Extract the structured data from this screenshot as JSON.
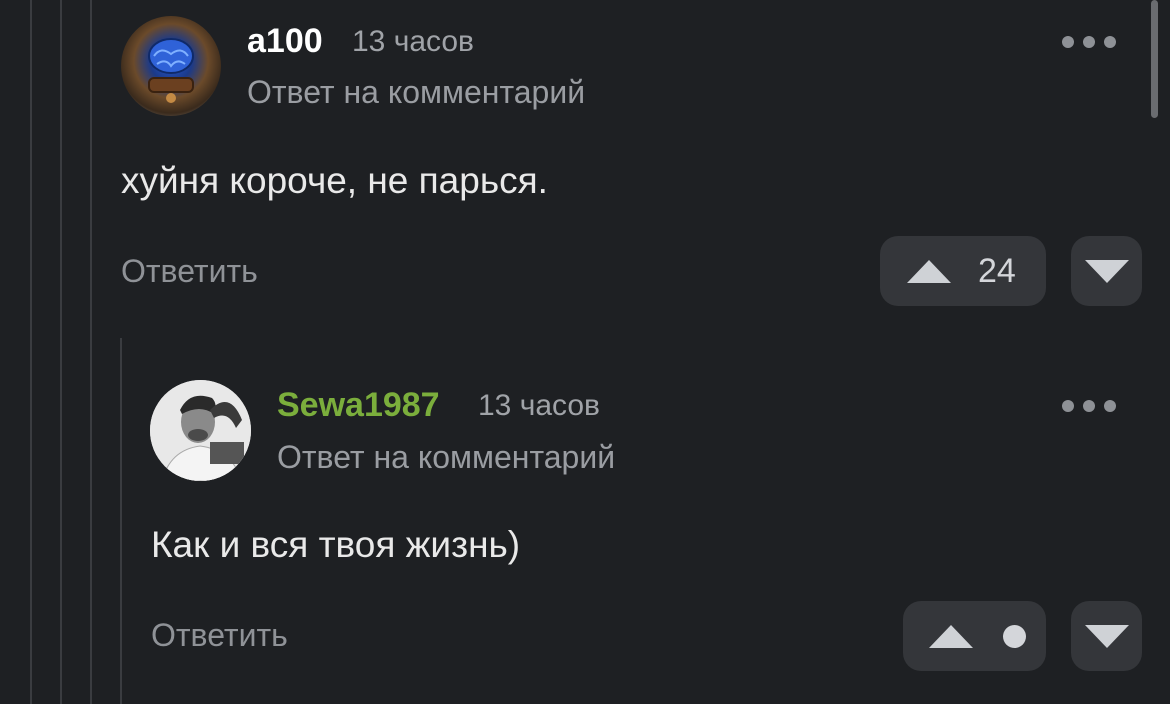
{
  "comments": [
    {
      "username": "a100",
      "username_color": "#ffffff",
      "time": "13 часов",
      "subtitle": "Ответ на комментарий",
      "text": "хуйня короче, не парься.",
      "reply_label": "Ответить",
      "upvotes": "24"
    },
    {
      "username": "Sewa1987",
      "username_color": "#7bae3c",
      "time": "13 часов",
      "subtitle": "Ответ на комментарий",
      "text": "Как и вся твоя жизнь)",
      "reply_label": "Ответить",
      "upvotes_hidden": true
    }
  ],
  "colors": {
    "background": "#1e2023",
    "vote_box": "#34363a",
    "thread_line": "#3a3c40"
  },
  "icons": {
    "more": "more-horizontal-icon",
    "upvote": "triangle-up-icon",
    "downvote": "triangle-down-icon"
  }
}
